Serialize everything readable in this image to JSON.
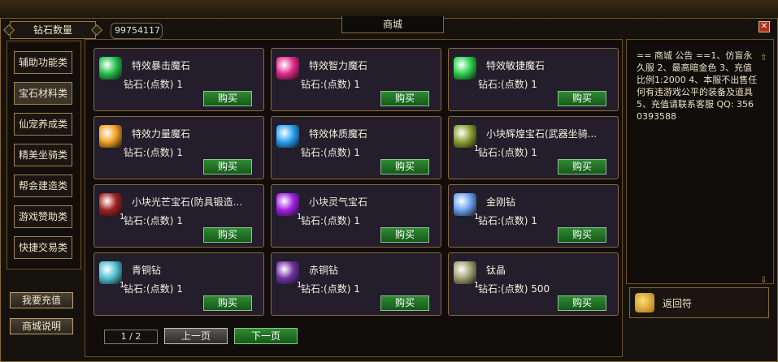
{
  "header": {
    "diamond_label": "钻石数量",
    "diamond_count": "99754117",
    "title": "商城",
    "close": "✕"
  },
  "categories": [
    {
      "label": "辅助功能类",
      "active": false
    },
    {
      "label": "宝石材料类",
      "active": true
    },
    {
      "label": "仙宠养成类",
      "active": false
    },
    {
      "label": "精美坐骑类",
      "active": false
    },
    {
      "label": "帮会建造类",
      "active": false
    },
    {
      "label": "游戏赞助类",
      "active": false
    },
    {
      "label": "快捷交易类",
      "active": false
    }
  ],
  "side_buttons": {
    "recharge": "我要充值",
    "help": "商城说明"
  },
  "items": [
    {
      "name": "特效暴击魔石",
      "price": "钻石:(点数) 1",
      "qty": "",
      "color": "#22c04a"
    },
    {
      "name": "特效智力魔石",
      "price": "钻石:(点数) 1",
      "qty": "",
      "color": "#e02a8a"
    },
    {
      "name": "特效敏捷魔石",
      "price": "钻石:(点数) 1",
      "qty": "",
      "color": "#2ad04a"
    },
    {
      "name": "特效力量魔石",
      "price": "钻石:(点数) 1",
      "qty": "",
      "color": "#f0a020"
    },
    {
      "name": "特效体质魔石",
      "price": "钻石:(点数) 1",
      "qty": "",
      "color": "#2aa0f0"
    },
    {
      "name": "小块辉煌宝石(武器坐骑...",
      "price": "钻石:(点数) 1",
      "qty": "1",
      "color": "#8aa030"
    },
    {
      "name": "小块光芒宝石(防具锻造...",
      "price": "钻石:(点数) 1",
      "qty": "1",
      "color": "#a02020"
    },
    {
      "name": "小块灵气宝石",
      "price": "钻石:(点数) 1",
      "qty": "1",
      "color": "#a020e0"
    },
    {
      "name": "金刚钻",
      "price": "钻石:(点数) 1",
      "qty": "1",
      "color": "#6aa0f0"
    },
    {
      "name": "青铜钻",
      "price": "钻石:(点数) 1",
      "qty": "1",
      "color": "#50c0d0"
    },
    {
      "name": "赤铜钻",
      "price": "钻石:(点数) 1",
      "qty": "1",
      "color": "#7030a0"
    },
    {
      "name": "钛晶",
      "price": "钻石:(点数) 500",
      "qty": "1",
      "color": "#a0a070"
    }
  ],
  "buy_label": "购买",
  "pagination": {
    "page": "1 / 2",
    "prev": "上一页",
    "next": "下一页"
  },
  "notice": {
    "text": "== 商城 公告 ==1、仿盲永久服 2、最高暗金色 3、充值比例1:2000 4、本服不出售任何有违游戏公平的装备及道具 5、充值请联系客服 QQ: 3560393588",
    "up": "⇧",
    "down": "⇩"
  },
  "return_item": {
    "name": "返回符",
    "color": "#e0b030"
  }
}
